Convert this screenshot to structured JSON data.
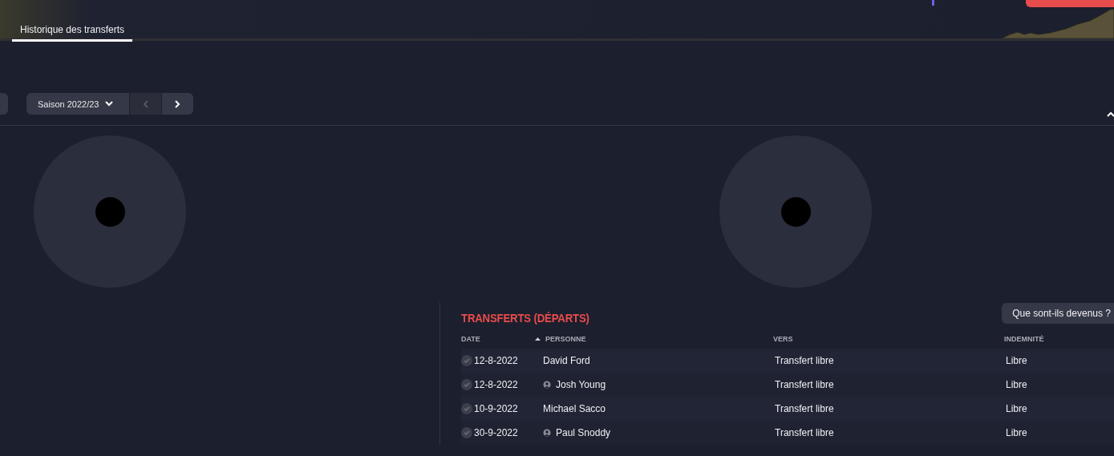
{
  "tabs": [
    {
      "label": "Historique des transferts",
      "selected": true
    }
  ],
  "season": {
    "label": "Saison 2022/23",
    "prev_disabled": true,
    "next_disabled": false
  },
  "departures": {
    "title": "TRANSFERTS (DÉPARTS)",
    "action": "Que sont-ils devenus ?",
    "columns": [
      {
        "label": "DATE",
        "sorted": false
      },
      {
        "label": "PERSONNE",
        "sorted": true
      },
      {
        "label": "VERS",
        "sorted": false
      },
      {
        "label": "INDEMNITÉ",
        "sorted": false
      }
    ],
    "rows": [
      {
        "date": "12-8-2022",
        "person": "David Ford",
        "icon": false,
        "to": "Transfert libre",
        "fee": "Libre"
      },
      {
        "date": "12-8-2022",
        "person": "Josh Young",
        "icon": true,
        "to": "Transfert libre",
        "fee": "Libre"
      },
      {
        "date": "10-9-2022",
        "person": "Michael Sacco",
        "icon": false,
        "to": "Transfert libre",
        "fee": "Libre"
      },
      {
        "date": "30-9-2022",
        "person": "Paul Snoddy",
        "icon": true,
        "to": "Transfert libre",
        "fee": "Libre"
      }
    ]
  }
}
